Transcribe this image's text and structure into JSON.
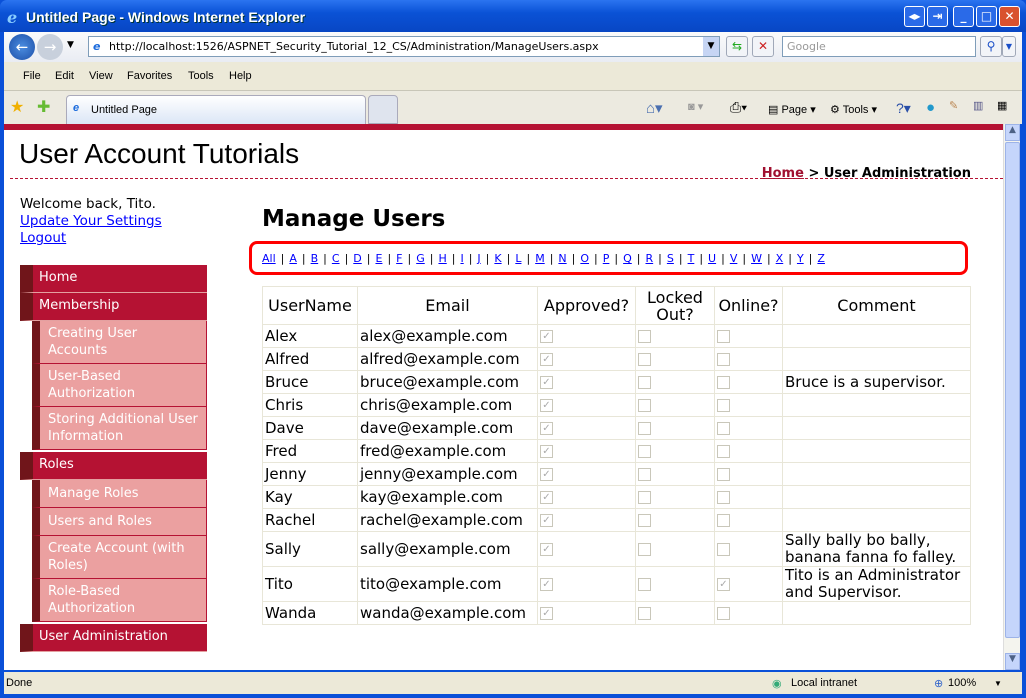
{
  "window": {
    "title": "Untitled Page - Windows Internet Explorer"
  },
  "browser": {
    "url": "http://localhost:1526/ASPNET_Security_Tutorial_12_CS/Administration/ManageUsers.aspx",
    "search_placeholder": "Google",
    "menu": [
      "File",
      "Edit",
      "View",
      "Favorites",
      "Tools",
      "Help"
    ],
    "tab": "Untitled Page",
    "page_label": "Page",
    "tools_label": "Tools"
  },
  "status": {
    "text": "Done",
    "zone": "Local intranet",
    "zoom": "100%"
  },
  "site": {
    "title": "User Account Tutorials",
    "breadcrumb_home": "Home",
    "breadcrumb_sep": " > ",
    "breadcrumb_current": "User Administration",
    "welcome": "Welcome back, Tito.",
    "update_settings": "Update Your Settings",
    "logout": "Logout"
  },
  "nav": [
    {
      "label": "Home",
      "level": 0
    },
    {
      "label": "Membership",
      "level": 0
    },
    {
      "label": "Creating User Accounts",
      "level": 1
    },
    {
      "label": "User-Based Authorization",
      "level": 1
    },
    {
      "label": "Storing Additional User Information",
      "level": 1
    },
    {
      "label": "Roles",
      "level": 0
    },
    {
      "label": "Manage Roles",
      "level": 1
    },
    {
      "label": "Users and Roles",
      "level": 1
    },
    {
      "label": "Create Account (with Roles)",
      "level": 1
    },
    {
      "label": "Role-Based Authorization",
      "level": 1
    },
    {
      "label": "User Administration",
      "level": 0
    }
  ],
  "main": {
    "heading": "Manage Users",
    "letters": [
      "All",
      "A",
      "B",
      "C",
      "D",
      "E",
      "F",
      "G",
      "H",
      "I",
      "J",
      "K",
      "L",
      "M",
      "N",
      "O",
      "P",
      "Q",
      "R",
      "S",
      "T",
      "U",
      "V",
      "W",
      "X",
      "Y",
      "Z"
    ],
    "columns": [
      "UserName",
      "Email",
      "Approved?",
      "Locked Out?",
      "Online?",
      "Comment"
    ],
    "rows": [
      {
        "user": "Alex",
        "email": "alex@example.com",
        "approved": true,
        "locked": false,
        "online": false,
        "comment": ""
      },
      {
        "user": "Alfred",
        "email": "alfred@example.com",
        "approved": true,
        "locked": false,
        "online": false,
        "comment": ""
      },
      {
        "user": "Bruce",
        "email": "bruce@example.com",
        "approved": true,
        "locked": false,
        "online": false,
        "comment": "Bruce is a supervisor."
      },
      {
        "user": "Chris",
        "email": "chris@example.com",
        "approved": true,
        "locked": false,
        "online": false,
        "comment": ""
      },
      {
        "user": "Dave",
        "email": "dave@example.com",
        "approved": true,
        "locked": false,
        "online": false,
        "comment": ""
      },
      {
        "user": "Fred",
        "email": "fred@example.com",
        "approved": true,
        "locked": false,
        "online": false,
        "comment": ""
      },
      {
        "user": "Jenny",
        "email": "jenny@example.com",
        "approved": true,
        "locked": false,
        "online": false,
        "comment": ""
      },
      {
        "user": "Kay",
        "email": "kay@example.com",
        "approved": true,
        "locked": false,
        "online": false,
        "comment": ""
      },
      {
        "user": "Rachel",
        "email": "rachel@example.com",
        "approved": true,
        "locked": false,
        "online": false,
        "comment": ""
      },
      {
        "user": "Sally",
        "email": "sally@example.com",
        "approved": true,
        "locked": false,
        "online": false,
        "comment": "Sally bally bo bally, banana fanna fo falley."
      },
      {
        "user": "Tito",
        "email": "tito@example.com",
        "approved": true,
        "locked": false,
        "online": true,
        "comment": "Tito is an Administrator and Supervisor."
      },
      {
        "user": "Wanda",
        "email": "wanda@example.com",
        "approved": true,
        "locked": false,
        "online": false,
        "comment": ""
      }
    ]
  },
  "colors": {
    "brand": "#b51233",
    "brand_dark": "#70151a",
    "submenu": "#eba0a0",
    "highlight": "#ff0000"
  }
}
